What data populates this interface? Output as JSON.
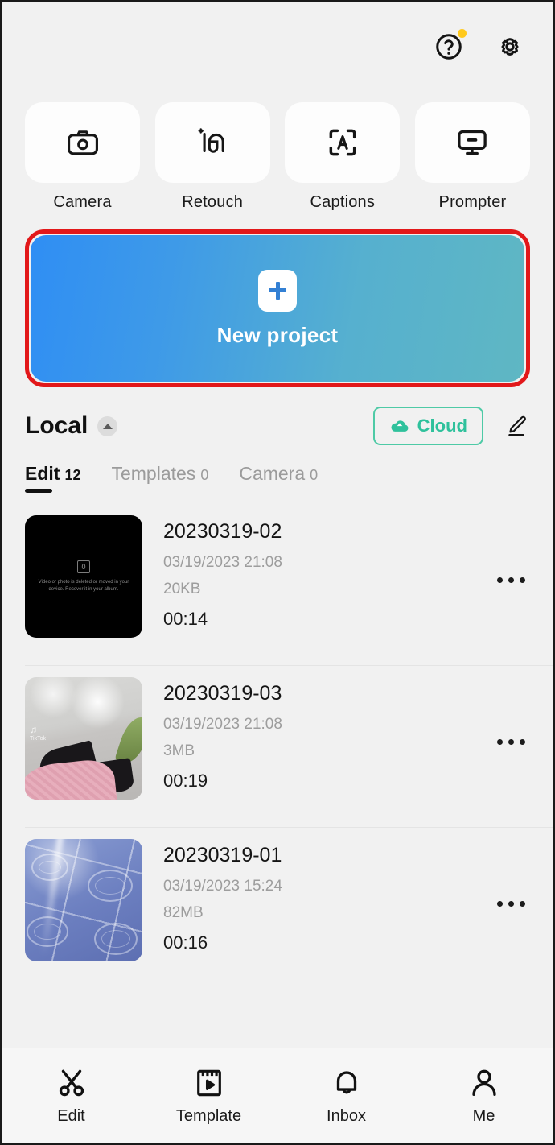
{
  "header": {
    "help_icon": "help-circle-icon",
    "help_badge": true,
    "settings_icon": "gear-icon"
  },
  "quick_actions": [
    {
      "label": "Camera",
      "icon": "camera-icon"
    },
    {
      "label": "Retouch",
      "icon": "retouch-icon"
    },
    {
      "label": "Captions",
      "icon": "captions-icon"
    },
    {
      "label": "Prompter",
      "icon": "prompter-icon"
    }
  ],
  "new_project": {
    "label": "New project",
    "plus_icon": "plus-icon",
    "gradient_from": "#2f8ef4",
    "gradient_to": "#5fb7c3",
    "highlight_color": "#e2181a"
  },
  "library": {
    "title": "Local",
    "collapse_icon": "chevron-up-icon",
    "cloud_button": {
      "label": "Cloud",
      "icon": "cloud-upload-icon",
      "color": "#2fc19c"
    },
    "edit_icon": "pencil-icon",
    "tabs": [
      {
        "label": "Edit",
        "count": "12",
        "active": true
      },
      {
        "label": "Templates",
        "count": "0",
        "active": false
      },
      {
        "label": "Camera",
        "count": "0",
        "active": false
      }
    ]
  },
  "projects": [
    {
      "title": "20230319-02",
      "datetime": "03/19/2023 21:08",
      "size": "20KB",
      "duration": "00:14",
      "thumb": "missing",
      "thumb_message": "Video or photo is deleted or moved in your device. Recover it in your album.",
      "more_icon": "more-horizontal-icon"
    },
    {
      "title": "20230319-03",
      "datetime": "03/19/2023 21:08",
      "size": "3MB",
      "duration": "00:19",
      "thumb": "photo-shoes",
      "watermark": "TikTok",
      "more_icon": "more-horizontal-icon"
    },
    {
      "title": "20230319-01",
      "datetime": "03/19/2023 15:24",
      "size": "82MB",
      "duration": "00:16",
      "thumb": "photo-floor",
      "more_icon": "more-horizontal-icon"
    }
  ],
  "bottom_nav": [
    {
      "label": "Edit",
      "icon": "scissors-icon"
    },
    {
      "label": "Template",
      "icon": "film-card-icon"
    },
    {
      "label": "Inbox",
      "icon": "bell-icon"
    },
    {
      "label": "Me",
      "icon": "person-icon"
    }
  ]
}
